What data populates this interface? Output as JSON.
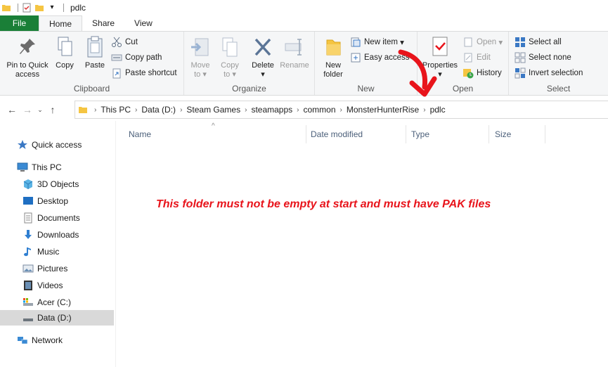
{
  "window": {
    "title": "pdlc"
  },
  "tabs": [
    {
      "label": "File"
    },
    {
      "label": "Home"
    },
    {
      "label": "Share"
    },
    {
      "label": "View"
    }
  ],
  "ribbon": {
    "clipboard": {
      "label": "Clipboard",
      "pin_label_1": "Pin to Quick",
      "pin_label_2": "access",
      "copy": "Copy",
      "paste": "Paste",
      "cut": "Cut",
      "copy_path": "Copy path",
      "paste_shortcut": "Paste shortcut"
    },
    "organize": {
      "label": "Organize",
      "move_1": "Move",
      "move_2": "to",
      "copy_1": "Copy",
      "copy_2": "to",
      "delete": "Delete",
      "rename": "Rename"
    },
    "new": {
      "label": "New",
      "new_folder_1": "New",
      "new_folder_2": "folder",
      "new_item": "New item",
      "easy_access": "Easy access"
    },
    "open": {
      "label": "Open",
      "properties": "Properties",
      "open": "Open",
      "edit": "Edit",
      "history": "History"
    },
    "select": {
      "label": "Select",
      "select_all": "Select all",
      "select_none": "Select none",
      "invert_selection": "Invert selection"
    }
  },
  "address": {
    "breadcrumbs": [
      "This PC",
      "Data (D:)",
      "Steam Games",
      "steamapps",
      "common",
      "MonsterHunterRise",
      "pdlc"
    ]
  },
  "sidebar": {
    "items": [
      {
        "label": "Quick access",
        "icon": "star-icon"
      },
      {
        "label": "This PC",
        "icon": "computer-icon"
      },
      {
        "label": "3D Objects",
        "icon": "cube-icon"
      },
      {
        "label": "Desktop",
        "icon": "desktop-icon"
      },
      {
        "label": "Documents",
        "icon": "document-icon"
      },
      {
        "label": "Downloads",
        "icon": "download-icon"
      },
      {
        "label": "Music",
        "icon": "music-icon"
      },
      {
        "label": "Pictures",
        "icon": "pictures-icon"
      },
      {
        "label": "Videos",
        "icon": "video-icon"
      },
      {
        "label": "Acer (C:)",
        "icon": "drive-icon"
      },
      {
        "label": "Data (D:)",
        "icon": "drive-icon"
      },
      {
        "label": "Network",
        "icon": "network-icon"
      }
    ]
  },
  "columns": [
    {
      "label": "Name"
    },
    {
      "label": "Date modified"
    },
    {
      "label": "Type"
    },
    {
      "label": "Size"
    }
  ],
  "annotation": {
    "text": "This folder must not be empty at start and must have PAK files",
    "color": "#e8141b"
  },
  "colors": {
    "file_tab": "#1a7f37",
    "ribbon_bg": "#f5f6f7",
    "selected_bg": "#d9d9d9",
    "column_text": "#4c607a"
  }
}
